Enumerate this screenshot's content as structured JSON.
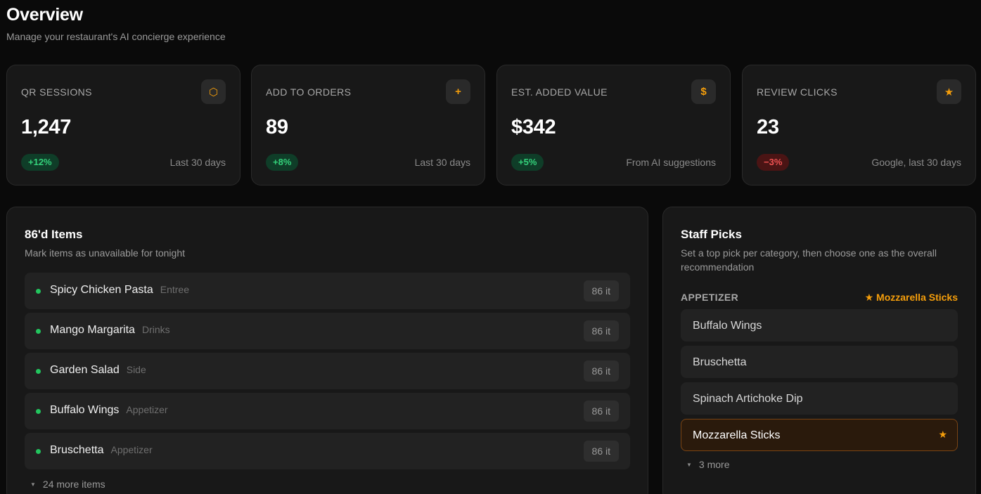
{
  "header": {
    "title": "Overview",
    "subtitle": "Manage your restaurant's AI concierge experience"
  },
  "stats": [
    {
      "label": "QR SESSIONS",
      "icon": "hexagon-icon",
      "glyph": "⬡",
      "value": "1,247",
      "change": "+12%",
      "trend": "up",
      "period": "Last 30 days"
    },
    {
      "label": "ADD TO ORDERS",
      "icon": "plus-icon",
      "glyph": "+",
      "value": "89",
      "change": "+8%",
      "trend": "up",
      "period": "Last 30 days"
    },
    {
      "label": "EST. ADDED VALUE",
      "icon": "dollar-icon",
      "glyph": "$",
      "value": "$342",
      "change": "+5%",
      "trend": "up",
      "period": "From AI suggestions"
    },
    {
      "label": "REVIEW CLICKS",
      "icon": "star-icon",
      "glyph": "★",
      "value": "23",
      "change": "−3%",
      "trend": "down",
      "period": "Google, last 30 days"
    }
  ],
  "items86": {
    "title": "86'd Items",
    "subtitle": "Mark items as unavailable for tonight",
    "button_label": "86 it",
    "rows": [
      {
        "name": "Spicy Chicken Pasta",
        "category": "Entree"
      },
      {
        "name": "Mango Margarita",
        "category": "Drinks"
      },
      {
        "name": "Garden Salad",
        "category": "Side"
      },
      {
        "name": "Buffalo Wings",
        "category": "Appetizer"
      },
      {
        "name": "Bruschetta",
        "category": "Appetizer"
      }
    ],
    "more": "24 more items"
  },
  "staff_picks": {
    "title": "Staff Picks",
    "subtitle": "Set a top pick per category, then choose one as the overall recommendation",
    "category": "APPETIZER",
    "current_pick": "★ Mozzarella Sticks",
    "options": [
      {
        "name": "Buffalo Wings",
        "selected": false
      },
      {
        "name": "Bruschetta",
        "selected": false
      },
      {
        "name": "Spinach Artichoke Dip",
        "selected": false
      },
      {
        "name": "Mozzarella Sticks",
        "selected": true
      }
    ],
    "selected_star": "★",
    "more": "3 more"
  },
  "colors": {
    "accent": "#f59e0b",
    "positive": "#34d27b",
    "negative": "#f05252",
    "background": "#0a0a0a",
    "card": "#181818"
  }
}
